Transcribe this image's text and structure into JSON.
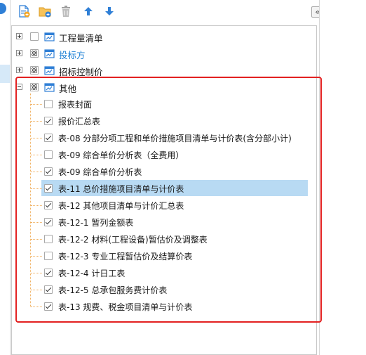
{
  "colors": {
    "accent": "#1a7fd4",
    "selection": "#b8daf3",
    "highlight_frame": "#e32121",
    "toolbar_icon": "#2f7fd6"
  },
  "toolbar": {
    "buttons": [
      {
        "name": "add-file-icon"
      },
      {
        "name": "add-folder-icon"
      },
      {
        "name": "delete-icon"
      },
      {
        "name": "move-up-icon"
      },
      {
        "name": "move-down-icon"
      }
    ],
    "collapse_label": "«"
  },
  "tree": {
    "top_nodes": [
      {
        "label": "工程量清单",
        "expander": "plus",
        "check": "unchecked"
      },
      {
        "label": "投标方",
        "expander": "plus",
        "check": "partial",
        "accent": true
      },
      {
        "label": "招标控制价",
        "expander": "plus",
        "check": "partial"
      },
      {
        "label": "其他",
        "expander": "minus",
        "check": "partial"
      }
    ],
    "children": [
      {
        "label": "报表封面",
        "checked": false
      },
      {
        "label": "报价汇总表",
        "checked": true
      },
      {
        "label": "表-08 分部分项工程和单价措施项目清单与计价表(含分部小计)",
        "checked": true
      },
      {
        "label": "表-09 综合单价分析表（全费用）",
        "checked": false
      },
      {
        "label": "表-09 综合单价分析表",
        "checked": true
      },
      {
        "label": "表-11 总价措施项目清单与计价表",
        "checked": true,
        "selected": true
      },
      {
        "label": "表-12 其他项目清单与计价汇总表",
        "checked": true
      },
      {
        "label": "表-12-1 暂列金额表",
        "checked": true
      },
      {
        "label": "表-12-2 材料(工程设备)暂估价及调整表",
        "checked": false
      },
      {
        "label": "表-12-3 专业工程暂估价及结算价表",
        "checked": false
      },
      {
        "label": "表-12-4 计日工表",
        "checked": true
      },
      {
        "label": "表-12-5 总承包服务费计价表",
        "checked": true
      },
      {
        "label": "表-13 规费、税金项目清单与计价表",
        "checked": true
      }
    ]
  }
}
